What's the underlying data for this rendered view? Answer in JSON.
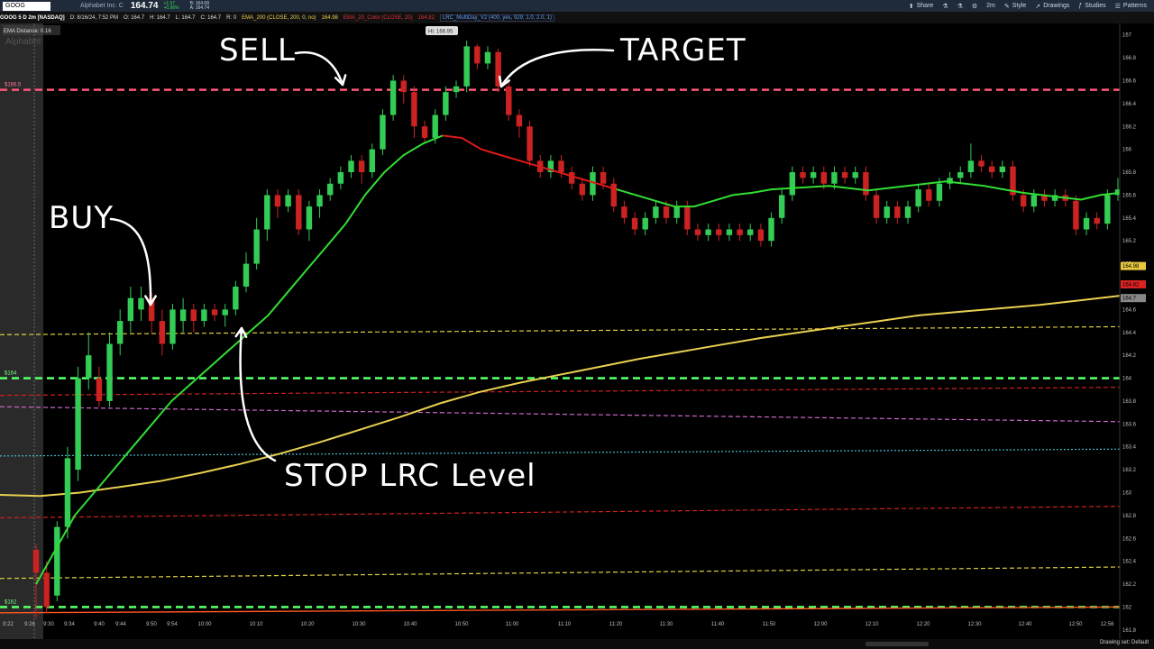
{
  "header": {
    "symbol": "GOOG",
    "company": "Alphabet Inc. C",
    "last_price": "164.74",
    "change": "+1.57",
    "change_pct": "+0.96%",
    "bid": "B: 164.68",
    "ask": "A: 164.74",
    "tools": [
      {
        "icon": "share-icon",
        "label": "Share"
      },
      {
        "icon": "flask-icon",
        "label": ""
      },
      {
        "icon": "flask-icon",
        "label": ""
      },
      {
        "icon": "gear-icon",
        "label": ""
      },
      {
        "icon": "timeframe",
        "label": "2m"
      },
      {
        "icon": "style-icon",
        "label": "Style"
      },
      {
        "icon": "drawings-icon",
        "label": "Drawings"
      },
      {
        "icon": "studies-icon",
        "label": "Studies"
      },
      {
        "icon": "patterns-icon",
        "label": "Patterns"
      }
    ]
  },
  "infobar": {
    "title": "GOOG 5 D 2m [NASDAQ]",
    "date": "D: 8/16/24, 7:52 PM",
    "open": "O: 164.7",
    "high": "H: 164.7",
    "low": "L: 164.7",
    "close": "C: 164.7",
    "r": "R: 0",
    "ema200": "EMA_200 (CLOSE, 200, 0, no)",
    "ema200_val": "164.98",
    "ema20": "EMA_20_Color (CLOSE, 20)",
    "ema20_val": "164.82",
    "lrc": "LRC_MultiDay_V2 (400, yes, 929, 1.0, 2.0, 1)"
  },
  "chart_overlay": {
    "ema_distance": "EMA Distance: 0.16",
    "watermark": "Alphabet",
    "hi_label": "Hi: 166.95",
    "footer": "Drawing set: Default"
  },
  "annotations": {
    "buy": "BUY",
    "sell": "SELL",
    "target": "TARGET",
    "stop": "STOP LRC Level"
  },
  "colors": {
    "up": "#33cc55",
    "down": "#cc2222",
    "target_line": "#ff5577",
    "support_line": "#55ff66",
    "ema200": "#e8d050",
    "ema20_up": "#33dd33",
    "ema20_down": "#dd1a1a",
    "lrc_yellow": "#e0d040",
    "lrc_red": "#d02020",
    "lrc_magenta": "#cc66cc",
    "lrc_cyan": "#44bbcc"
  },
  "chart_data": {
    "type": "candlestick",
    "ylim": [
      161.72,
      167.1
    ],
    "y_ticks": [
      "167",
      "166.8",
      "166.6",
      "166.4",
      "166.2",
      "166",
      "165.8",
      "165.6",
      "165.4",
      "165.2",
      "165",
      "164.8",
      "164.6",
      "164.4",
      "164.2",
      "164",
      "163.8",
      "163.6",
      "163.4",
      "163.2",
      "163",
      "162.8",
      "162.6",
      "162.4",
      "162.2",
      "162",
      "161.8"
    ],
    "x_ticks": [
      "9:22",
      "9:26",
      "9:30",
      "9:34",
      "9:40",
      "9:44",
      "9:50",
      "9:54",
      "10:00",
      "10:10",
      "10:20",
      "10:30",
      "10:40",
      "10:50",
      "11:00",
      "11:10",
      "11:20",
      "11:30",
      "11:40",
      "11:50",
      "12:00",
      "12:10",
      "12:20",
      "12:30",
      "12:40",
      "12:50",
      "12:56"
    ],
    "price_tags": [
      {
        "label": "164.98",
        "value": 164.98,
        "color": "#e8c840"
      },
      {
        "label": "164.82",
        "value": 164.82,
        "color": "#dd2222"
      },
      {
        "label": "164.7",
        "value": 164.7,
        "color": "#888888"
      }
    ],
    "level_labels": [
      {
        "label": "$166.5",
        "value": 166.52
      },
      {
        "label": "$164",
        "value": 164.0
      },
      {
        "label": "$162",
        "value": 162.0
      }
    ],
    "candles": [
      [
        162.5,
        162.3,
        162.55,
        161.9
      ],
      [
        162.3,
        162.0,
        162.4,
        161.95
      ],
      [
        162.1,
        162.7,
        162.75,
        162.05
      ],
      [
        162.7,
        163.3,
        163.4,
        162.6
      ],
      [
        163.2,
        164.0,
        164.1,
        163.1
      ],
      [
        164.0,
        164.2,
        164.4,
        163.9
      ],
      [
        164.0,
        163.8,
        164.1,
        163.75
      ],
      [
        163.8,
        164.3,
        164.4,
        163.75
      ],
      [
        164.3,
        164.5,
        164.6,
        164.2
      ],
      [
        164.5,
        164.7,
        164.8,
        164.4
      ],
      [
        164.6,
        164.7,
        164.8,
        164.5
      ],
      [
        164.7,
        164.5,
        164.75,
        164.4
      ],
      [
        164.5,
        164.3,
        164.6,
        164.2
      ],
      [
        164.3,
        164.6,
        164.65,
        164.25
      ],
      [
        164.5,
        164.6,
        164.7,
        164.4
      ],
      [
        164.6,
        164.5,
        164.65,
        164.4
      ],
      [
        164.5,
        164.6,
        164.65,
        164.45
      ],
      [
        164.6,
        164.55,
        164.65,
        164.5
      ],
      [
        164.55,
        164.6,
        164.65,
        164.45
      ],
      [
        164.6,
        164.8,
        164.85,
        164.55
      ],
      [
        164.8,
        165.0,
        165.1,
        164.75
      ],
      [
        165.0,
        165.3,
        165.4,
        164.95
      ],
      [
        165.3,
        165.6,
        165.65,
        165.2
      ],
      [
        165.6,
        165.5,
        165.65,
        165.4
      ],
      [
        165.5,
        165.6,
        165.65,
        165.45
      ],
      [
        165.6,
        165.3,
        165.65,
        165.25
      ],
      [
        165.3,
        165.5,
        165.55,
        165.2
      ],
      [
        165.5,
        165.6,
        165.65,
        165.4
      ],
      [
        165.6,
        165.7,
        165.75,
        165.55
      ],
      [
        165.7,
        165.8,
        165.85,
        165.65
      ],
      [
        165.8,
        165.9,
        165.95,
        165.75
      ],
      [
        165.9,
        165.8,
        165.95,
        165.7
      ],
      [
        165.8,
        166.0,
        166.05,
        165.75
      ],
      [
        166.0,
        166.3,
        166.35,
        165.95
      ],
      [
        166.3,
        166.6,
        166.65,
        166.25
      ],
      [
        166.6,
        166.5,
        166.65,
        166.4
      ],
      [
        166.5,
        166.2,
        166.55,
        166.1
      ],
      [
        166.2,
        166.1,
        166.25,
        166.05
      ],
      [
        166.1,
        166.3,
        166.35,
        166.05
      ],
      [
        166.3,
        166.5,
        166.55,
        166.25
      ],
      [
        166.5,
        166.55,
        166.6,
        166.45
      ],
      [
        166.55,
        166.9,
        166.95,
        166.5
      ],
      [
        166.9,
        166.75,
        166.92,
        166.7
      ],
      [
        166.75,
        166.85,
        166.9,
        166.7
      ],
      [
        166.85,
        166.55,
        166.88,
        166.5
      ],
      [
        166.55,
        166.3,
        166.6,
        166.25
      ],
      [
        166.3,
        166.2,
        166.35,
        166.1
      ],
      [
        166.2,
        165.9,
        166.25,
        165.85
      ],
      [
        165.9,
        165.8,
        165.95,
        165.75
      ],
      [
        165.8,
        165.9,
        165.95,
        165.75
      ],
      [
        165.9,
        165.8,
        165.95,
        165.75
      ],
      [
        165.8,
        165.7,
        165.85,
        165.65
      ],
      [
        165.7,
        165.6,
        165.75,
        165.55
      ],
      [
        165.6,
        165.8,
        165.85,
        165.55
      ],
      [
        165.8,
        165.7,
        165.85,
        165.65
      ],
      [
        165.7,
        165.5,
        165.75,
        165.45
      ],
      [
        165.5,
        165.4,
        165.55,
        165.35
      ],
      [
        165.4,
        165.3,
        165.45,
        165.25
      ],
      [
        165.3,
        165.4,
        165.45,
        165.25
      ],
      [
        165.4,
        165.5,
        165.55,
        165.35
      ],
      [
        165.5,
        165.4,
        165.55,
        165.35
      ],
      [
        165.4,
        165.5,
        165.55,
        165.35
      ],
      [
        165.5,
        165.3,
        165.55,
        165.25
      ],
      [
        165.3,
        165.25,
        165.35,
        165.2
      ],
      [
        165.25,
        165.3,
        165.35,
        165.2
      ],
      [
        165.3,
        165.25,
        165.35,
        165.2
      ],
      [
        165.25,
        165.3,
        165.35,
        165.2
      ],
      [
        165.3,
        165.25,
        165.35,
        165.2
      ],
      [
        165.25,
        165.3,
        165.35,
        165.2
      ],
      [
        165.3,
        165.2,
        165.35,
        165.15
      ],
      [
        165.2,
        165.4,
        165.45,
        165.15
      ],
      [
        165.4,
        165.6,
        165.65,
        165.35
      ],
      [
        165.6,
        165.8,
        165.85,
        165.55
      ],
      [
        165.8,
        165.75,
        165.85,
        165.7
      ],
      [
        165.75,
        165.8,
        165.85,
        165.7
      ],
      [
        165.8,
        165.7,
        165.85,
        165.65
      ],
      [
        165.7,
        165.8,
        165.85,
        165.65
      ],
      [
        165.8,
        165.75,
        165.85,
        165.7
      ],
      [
        165.75,
        165.8,
        165.85,
        165.7
      ],
      [
        165.8,
        165.6,
        165.85,
        165.55
      ],
      [
        165.6,
        165.4,
        165.65,
        165.35
      ],
      [
        165.4,
        165.5,
        165.55,
        165.35
      ],
      [
        165.5,
        165.4,
        165.55,
        165.35
      ],
      [
        165.4,
        165.5,
        165.55,
        165.35
      ],
      [
        165.5,
        165.65,
        165.7,
        165.45
      ],
      [
        165.65,
        165.55,
        165.7,
        165.5
      ],
      [
        165.55,
        165.7,
        165.75,
        165.5
      ],
      [
        165.7,
        165.75,
        165.8,
        165.65
      ],
      [
        165.75,
        165.8,
        165.85,
        165.7
      ],
      [
        165.8,
        165.9,
        166.05,
        165.75
      ],
      [
        165.9,
        165.85,
        165.95,
        165.8
      ],
      [
        165.85,
        165.8,
        165.9,
        165.75
      ],
      [
        165.8,
        165.85,
        165.9,
        165.75
      ],
      [
        165.85,
        165.6,
        165.9,
        165.55
      ],
      [
        165.6,
        165.5,
        165.65,
        165.45
      ],
      [
        165.5,
        165.6,
        165.65,
        165.45
      ],
      [
        165.6,
        165.55,
        165.65,
        165.5
      ],
      [
        165.55,
        165.6,
        165.65,
        165.5
      ],
      [
        165.6,
        165.55,
        165.65,
        165.5
      ],
      [
        165.55,
        165.3,
        165.6,
        165.25
      ],
      [
        165.3,
        165.4,
        165.45,
        165.25
      ],
      [
        165.4,
        165.35,
        165.45,
        165.3
      ],
      [
        165.35,
        165.6,
        165.65,
        165.3
      ],
      [
        165.6,
        165.65,
        165.75,
        165.55
      ]
    ],
    "ema20": [
      162.2,
      162.5,
      162.8,
      163.0,
      163.2,
      163.4,
      163.6,
      163.8,
      163.95,
      164.1,
      164.25,
      164.4,
      164.55,
      164.75,
      164.95,
      165.15,
      165.35,
      165.6,
      165.8,
      165.95,
      166.05,
      166.12,
      166.1,
      166.0,
      165.95,
      165.9,
      165.85,
      165.8,
      165.75,
      165.7,
      165.65,
      165.6,
      165.55,
      165.5,
      165.5,
      165.55,
      165.6,
      165.62,
      165.65,
      165.66,
      165.67,
      165.68,
      165.66,
      165.64,
      165.66,
      165.68,
      165.7,
      165.72,
      165.7,
      165.68,
      165.65,
      165.62,
      165.6,
      165.58,
      165.56,
      165.6,
      165.62
    ],
    "ema20_peak_index": 21,
    "ema200": [
      162.98,
      162.97,
      163.0,
      163.05,
      163.1,
      163.17,
      163.25,
      163.34,
      163.44,
      163.55,
      163.66,
      163.78,
      163.88,
      163.96,
      164.03,
      164.1,
      164.17,
      164.23,
      164.29,
      164.35,
      164.4,
      164.45,
      164.5,
      164.55,
      164.58,
      164.61,
      164.64,
      164.68,
      164.72
    ],
    "lrc_levels": [
      {
        "value": 166.52,
        "style": "target",
        "label": "$166.5"
      },
      {
        "value": 164.38,
        "end": 164.45,
        "style": "yellow"
      },
      {
        "value": 164.0,
        "style": "support",
        "label": "$164"
      },
      {
        "value": 163.85,
        "end": 163.92,
        "style": "red"
      },
      {
        "value": 163.75,
        "end": 163.62,
        "style": "magenta"
      },
      {
        "value": 163.32,
        "end": 163.38,
        "style": "cyan"
      },
      {
        "value": 162.78,
        "end": 162.88,
        "style": "red"
      },
      {
        "value": 162.25,
        "end": 162.35,
        "style": "yellow"
      },
      {
        "value": 162.0,
        "style": "support",
        "label": "$162"
      },
      {
        "value": 161.95,
        "end": 162.0,
        "style": "orange"
      }
    ]
  }
}
